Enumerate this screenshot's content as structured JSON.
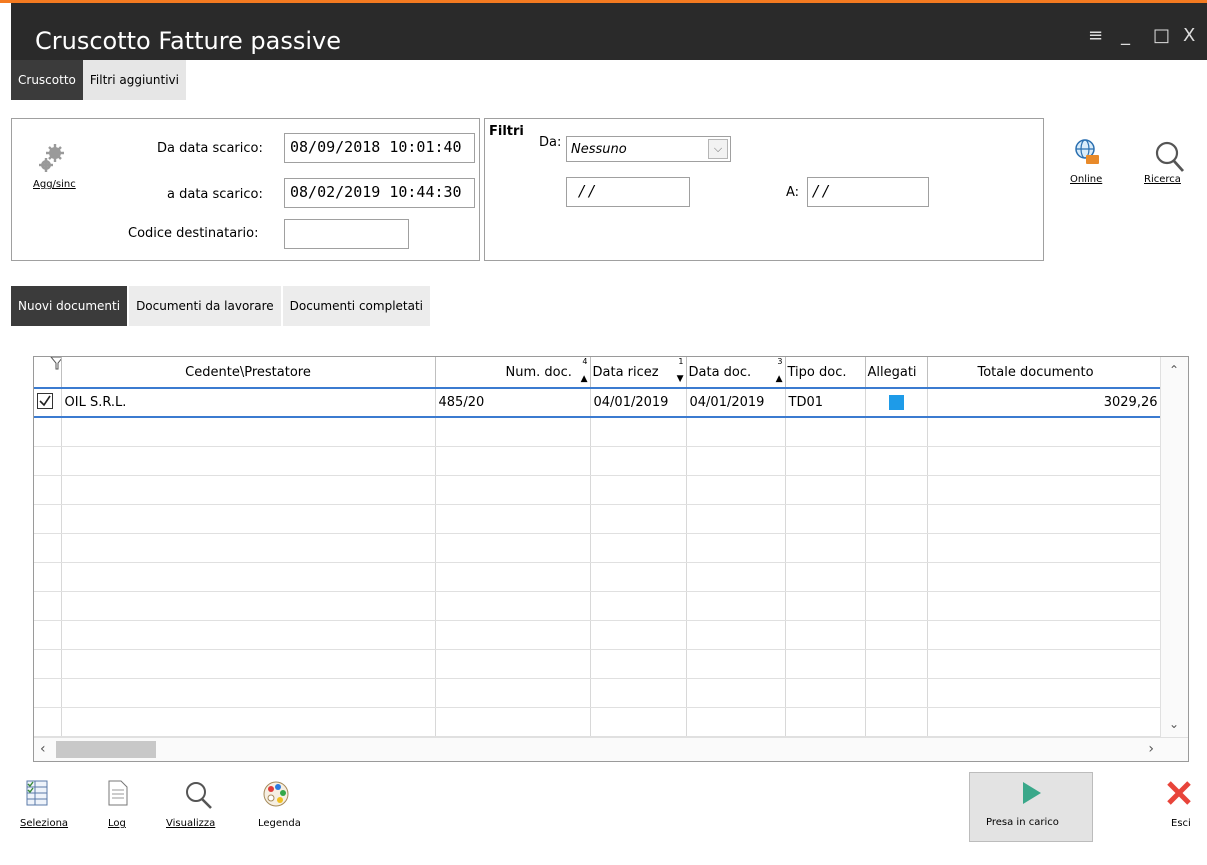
{
  "window": {
    "title": "Cruscotto Fatture passive",
    "controls": [
      "≡",
      "_",
      "□",
      "X"
    ]
  },
  "top_tabs": [
    {
      "label": "Cruscotto",
      "active": true
    },
    {
      "label": "Filtri aggiuntivi",
      "active": false
    }
  ],
  "sync": {
    "button_label": "Agg/sinc",
    "from_label": "Da data scarico:",
    "from_value": "08/09/2018 10:01:40",
    "to_label": "a data scarico:",
    "to_value": "08/02/2019 10:44:30",
    "code_label": "Codice destinatario:",
    "code_value": ""
  },
  "filters": {
    "title": "Filtri",
    "da_label": "Da:",
    "da_value": "Nessuno",
    "date_from": "/ /",
    "a_label": "A:",
    "date_to": "/ /"
  },
  "right_buttons": {
    "online": "Online",
    "search": "Ricerca"
  },
  "doc_tabs": [
    {
      "label": "Nuovi documenti",
      "active": true
    },
    {
      "label": "Documenti da lavorare",
      "active": false
    },
    {
      "label": "Documenti completati",
      "active": false
    }
  ],
  "grid": {
    "columns": [
      {
        "label": "Cedente\\Prestatore",
        "sort": ""
      },
      {
        "label": "Num. doc.",
        "sort": "4"
      },
      {
        "label": "Data ricez",
        "sort": "1"
      },
      {
        "label": "Data doc.",
        "sort": "3"
      },
      {
        "label": "Tipo doc.",
        "sort": ""
      },
      {
        "label": "Allegati",
        "sort": ""
      },
      {
        "label": "Totale documento",
        "sort": ""
      }
    ],
    "rows": [
      {
        "checked": true,
        "cedente": "OIL S.R.L.",
        "num_doc": "485/20",
        "data_ricez": "04/01/2019",
        "data_doc": "04/01/2019",
        "tipo_doc": "TD01",
        "allegati": true,
        "totale": "3029,26"
      }
    ]
  },
  "bottom_buttons": {
    "seleziona": "Seleziona",
    "log": "Log",
    "visualizza": "Visualizza",
    "legenda": "Legenda",
    "presa": "Presa in carico",
    "esci": "Esci"
  },
  "colors": {
    "accent": "#f47a20",
    "titlebar": "#2a2a2a",
    "selection": "#3b7bd0",
    "attachment": "#1e9be8",
    "exit": "#e8443a",
    "play": "#3aa88a"
  }
}
